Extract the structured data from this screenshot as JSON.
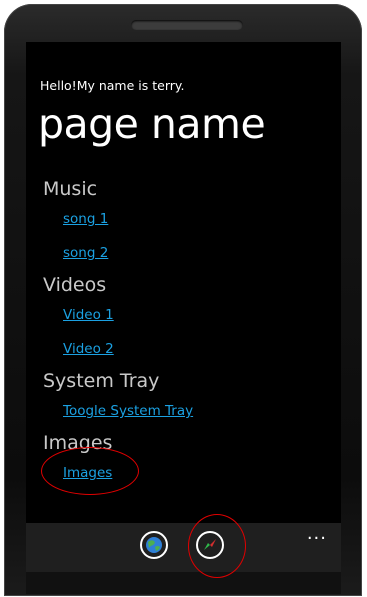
{
  "app": {
    "intro_text": "Hello!My name is terry.",
    "page_title": "page name"
  },
  "sections": [
    {
      "header": "Music",
      "links": [
        "song 1",
        "song 2"
      ]
    },
    {
      "header": "Videos",
      "links": [
        "Video 1",
        "Video 2"
      ]
    },
    {
      "header": "System Tray",
      "links": [
        "Toogle System Tray"
      ]
    },
    {
      "header": "Images",
      "links": [
        "Images"
      ]
    }
  ],
  "app_bar": {
    "buttons": [
      {
        "icon": "globe-icon"
      },
      {
        "icon": "compass-icon"
      }
    ],
    "more_label": "..."
  },
  "colors": {
    "accent": "#1ba1e2",
    "background": "#000000",
    "header_text": "#c9c9c9",
    "annotation": "#e00000"
  }
}
